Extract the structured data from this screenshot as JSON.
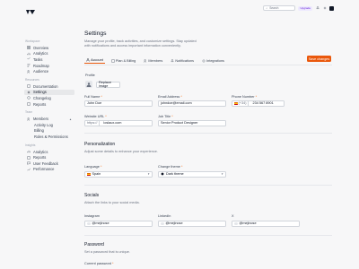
{
  "topbar": {
    "search_placeholder": "Search",
    "plan_label": "Upgrade"
  },
  "sidebar": {
    "workspace_title": "Workspace",
    "workspace_items": [
      {
        "label": "Overview"
      },
      {
        "label": "Analytics"
      },
      {
        "label": "Tasks"
      },
      {
        "label": "Roadmap"
      },
      {
        "label": "Audience"
      }
    ],
    "resources_title": "Resources",
    "resources_items": [
      {
        "label": "Documentation"
      },
      {
        "label": "Settings"
      },
      {
        "label": "Changelog"
      },
      {
        "label": "Reports"
      }
    ],
    "team_title": "Team",
    "team_items": [
      {
        "label": "Members"
      },
      {
        "label": "Activity Log"
      },
      {
        "label": "Billing"
      },
      {
        "label": "Roles & Permissions"
      }
    ],
    "insights_title": "Insights",
    "insights_items": [
      {
        "label": "Analytics"
      },
      {
        "label": "Reports"
      },
      {
        "label": "User Feedback"
      },
      {
        "label": "Performance"
      }
    ]
  },
  "page": {
    "title": "Settings",
    "subtitle": "Manage your profile, track activities, and customize settings. Stay updated with notifications and access important information conveniently.",
    "save_label": "Save changes"
  },
  "tabs": [
    {
      "label": "Account"
    },
    {
      "label": "Plan & Billing"
    },
    {
      "label": "Members"
    },
    {
      "label": "Notifications"
    },
    {
      "label": "Integrations"
    }
  ],
  "profile": {
    "label": "Profile",
    "replace_label": "Replace image"
  },
  "fields": {
    "full_name_label": "Full Name",
    "full_name_value": "John Doe",
    "email_label": "Email Address",
    "email_value": "johndoe@email.com",
    "phone_label": "Phone Number",
    "phone_code": "(+34)",
    "phone_value": "234 567 8901",
    "website_label": "Website URL",
    "website_prefix": "https://",
    "website_value": "loslaux.com",
    "job_label": "Job Title",
    "job_value": "Senior Product Designer"
  },
  "personalization": {
    "title": "Personalization",
    "helper": "Adjust some details to enhance your experience.",
    "language_label": "Language",
    "language_value": "Spain",
    "theme_label": "Change theme",
    "theme_value": "Dark theme"
  },
  "socials": {
    "title": "Socials",
    "helper": "Attach the links to your social media.",
    "instagram_label": "Instagram",
    "instagram_value": "@mejinose",
    "linkedin_label": "LinkedIn",
    "linkedin_value": "@mejinose",
    "x_label": "X",
    "x_value": "@mejinose"
  },
  "password": {
    "title": "Password",
    "helper": "Set a password that is unique.",
    "current_label": "Current password"
  },
  "colors": {
    "accent": "#ea580c",
    "required": "#f97316",
    "flag_red": "#c60b1e",
    "flag_yellow": "#ffc400"
  }
}
